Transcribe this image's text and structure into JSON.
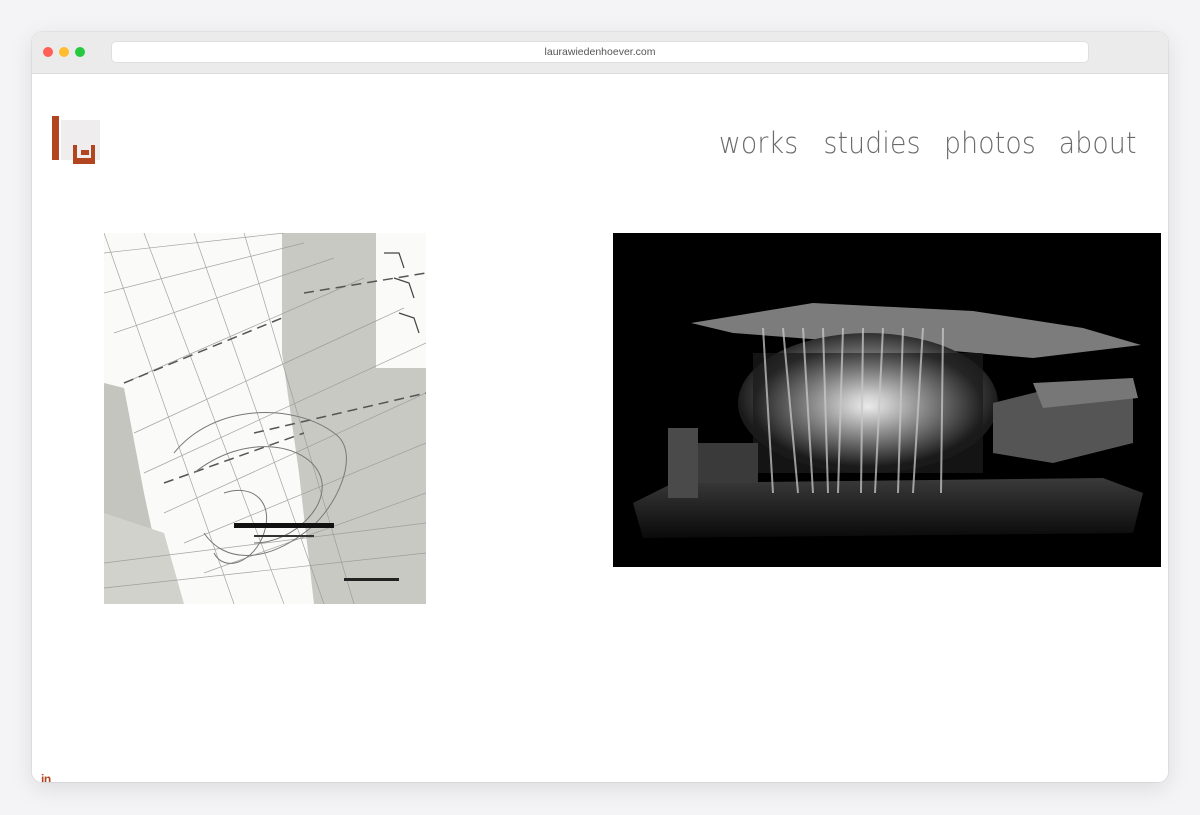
{
  "browser": {
    "url": "laurawiedenhoever.com"
  },
  "brand": {
    "logo_icon": "lw-monogram-logo",
    "accent_color": "#b2441f"
  },
  "nav": {
    "items": [
      {
        "label": "works"
      },
      {
        "label": "studies"
      },
      {
        "label": "photos"
      },
      {
        "label": "about"
      }
    ]
  },
  "gallery": {
    "items": [
      {
        "kind": "site-plan-drawing"
      },
      {
        "kind": "architectural-model-render"
      }
    ]
  },
  "footer": {
    "linkedin_label": "in",
    "linkedin_icon": "linkedin-icon"
  }
}
